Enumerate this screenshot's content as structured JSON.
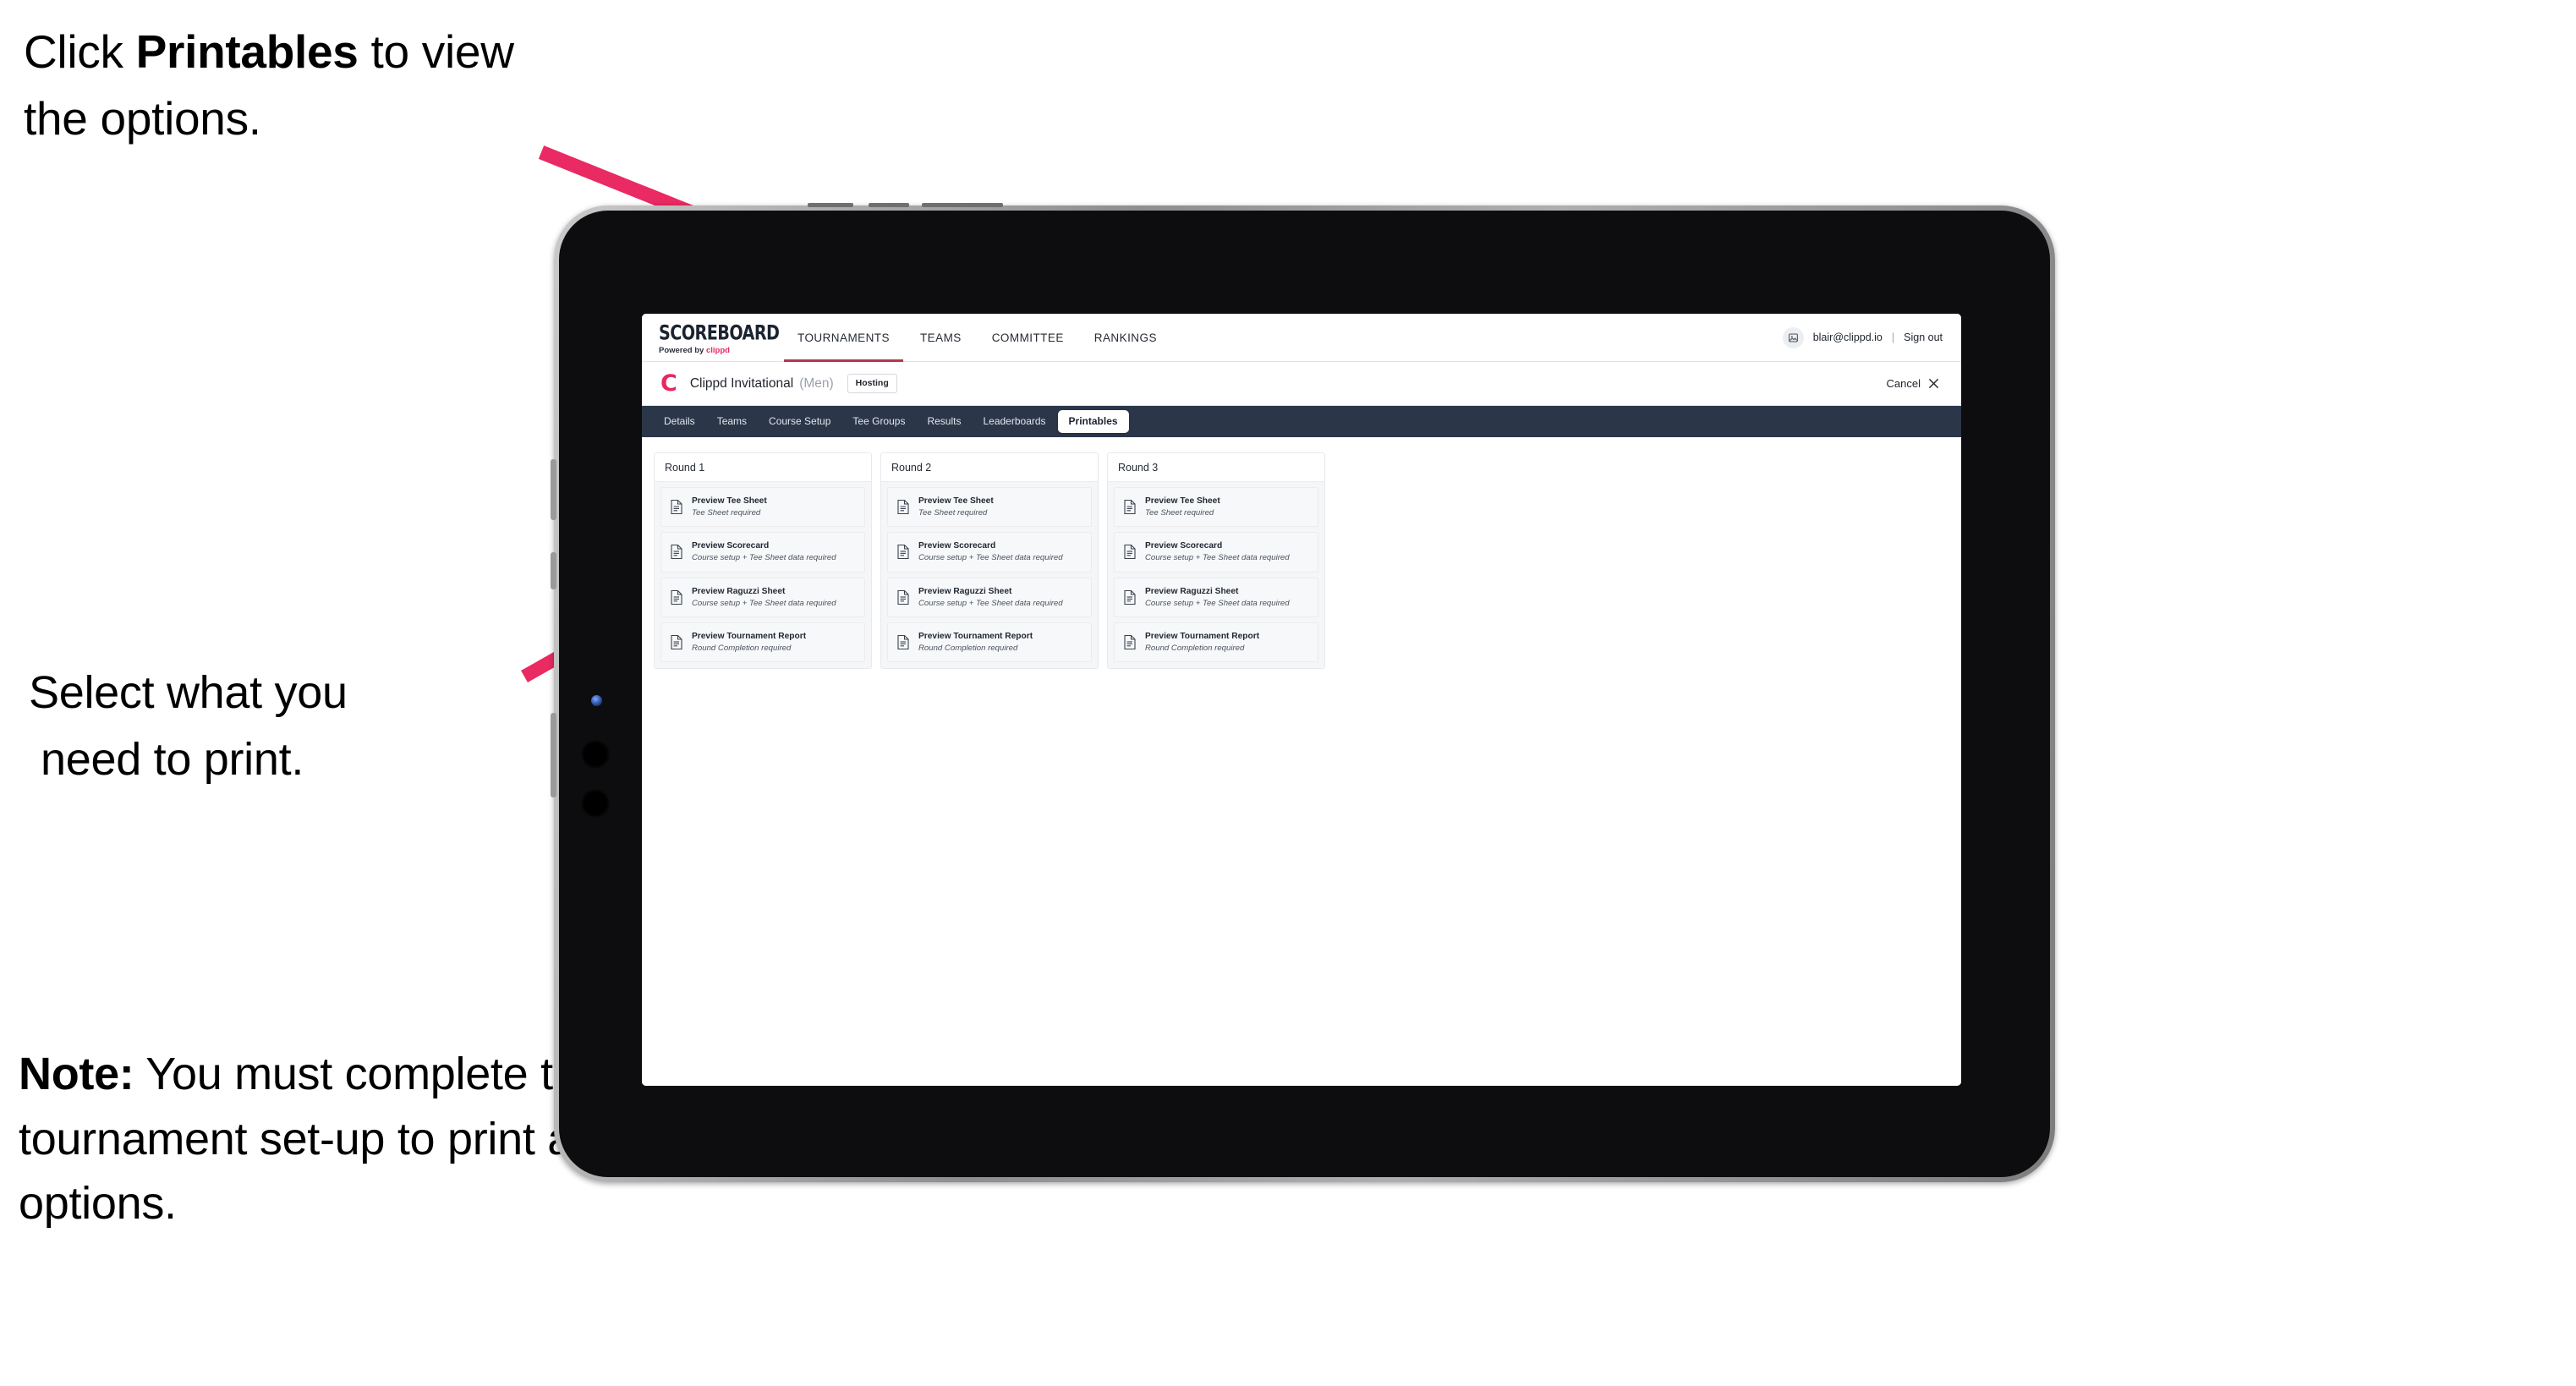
{
  "annotations": {
    "top": {
      "pre": "Click ",
      "bold": "Printables",
      "post": " to view the options."
    },
    "middle": {
      "line1": "Select what you",
      "line2": "need to print."
    },
    "note": {
      "bold": "Note:",
      "text": " You must complete the tournament set-up to print all the options."
    }
  },
  "colors": {
    "accent_pink": "#ea2a62",
    "brand_red": "#e8285f",
    "subnav_bg": "#2b3649",
    "active_tab_underline": "#b4384f"
  },
  "app": {
    "logo": {
      "word": "SCOREBOARD",
      "powered_prefix": "Powered by ",
      "brand": "clippd"
    },
    "top_nav": [
      {
        "label": "TOURNAMENTS",
        "active": true
      },
      {
        "label": "TEAMS",
        "active": false
      },
      {
        "label": "COMMITTEE",
        "active": false
      },
      {
        "label": "RANKINGS",
        "active": false
      }
    ],
    "account": {
      "avatar_icon": "user-avatar-icon",
      "email": "blair@clippd.io",
      "separator": "|",
      "sign_out": "Sign out"
    },
    "tournament": {
      "logo_letter": "C",
      "name": "Clippd Invitational",
      "gender": "(Men)",
      "status_chip": "Hosting",
      "cancel_label": "Cancel",
      "cancel_icon": "close-icon"
    },
    "sub_nav": [
      {
        "label": "Details",
        "active": false
      },
      {
        "label": "Teams",
        "active": false
      },
      {
        "label": "Course Setup",
        "active": false
      },
      {
        "label": "Tee Groups",
        "active": false
      },
      {
        "label": "Results",
        "active": false
      },
      {
        "label": "Leaderboards",
        "active": false
      },
      {
        "label": "Printables",
        "active": true
      }
    ],
    "rounds": [
      {
        "title": "Round 1",
        "items": [
          {
            "icon": "document-icon",
            "title": "Preview Tee Sheet",
            "subtitle": "Tee Sheet required"
          },
          {
            "icon": "document-icon",
            "title": "Preview Scorecard",
            "subtitle": "Course setup + Tee Sheet data required"
          },
          {
            "icon": "document-icon",
            "title": "Preview Raguzzi Sheet",
            "subtitle": "Course setup + Tee Sheet data required"
          },
          {
            "icon": "document-icon",
            "title": "Preview Tournament Report",
            "subtitle": "Round Completion required"
          }
        ]
      },
      {
        "title": "Round 2",
        "items": [
          {
            "icon": "document-icon",
            "title": "Preview Tee Sheet",
            "subtitle": "Tee Sheet required"
          },
          {
            "icon": "document-icon",
            "title": "Preview Scorecard",
            "subtitle": "Course setup + Tee Sheet data required"
          },
          {
            "icon": "document-icon",
            "title": "Preview Raguzzi Sheet",
            "subtitle": "Course setup + Tee Sheet data required"
          },
          {
            "icon": "document-icon",
            "title": "Preview Tournament Report",
            "subtitle": "Round Completion required"
          }
        ]
      },
      {
        "title": "Round 3",
        "items": [
          {
            "icon": "document-icon",
            "title": "Preview Tee Sheet",
            "subtitle": "Tee Sheet required"
          },
          {
            "icon": "document-icon",
            "title": "Preview Scorecard",
            "subtitle": "Course setup + Tee Sheet data required"
          },
          {
            "icon": "document-icon",
            "title": "Preview Raguzzi Sheet",
            "subtitle": "Course setup + Tee Sheet data required"
          },
          {
            "icon": "document-icon",
            "title": "Preview Tournament Report",
            "subtitle": "Round Completion required"
          }
        ]
      }
    ]
  }
}
